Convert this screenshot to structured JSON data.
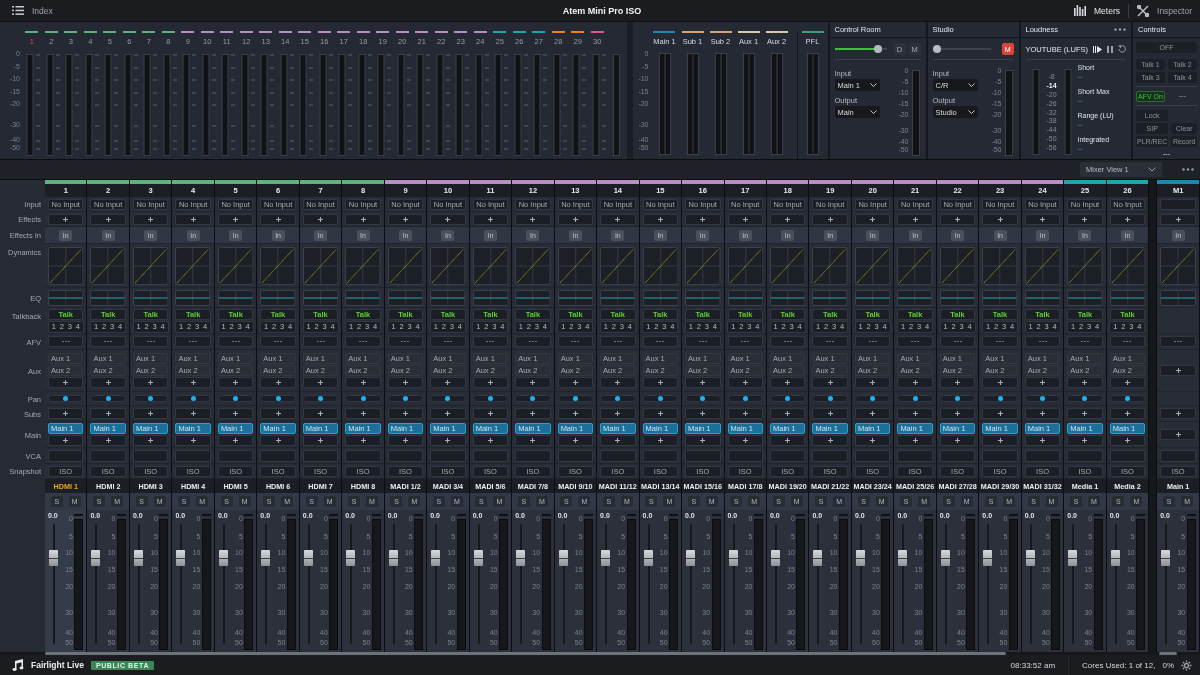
{
  "toolbar": {
    "index": "Index",
    "title": "Atem Mini Pro ISO",
    "meters": "Meters",
    "inspector": "Inspector"
  },
  "meter_bridge": {
    "scale": [
      "0",
      "-5",
      "-10",
      "-15",
      "-20",
      "-30",
      "-40",
      "-50"
    ],
    "channels": [
      {
        "number": "1",
        "color": "#5db37e",
        "selected": true
      },
      {
        "number": "2",
        "color": "#5db37e",
        "selected": false
      },
      {
        "number": "3",
        "color": "#5db37e",
        "selected": false
      },
      {
        "number": "4",
        "color": "#5db37e",
        "selected": false
      },
      {
        "number": "5",
        "color": "#5db37e",
        "selected": false
      },
      {
        "number": "6",
        "color": "#5db37e",
        "selected": false
      },
      {
        "number": "7",
        "color": "#5db37e",
        "selected": false
      },
      {
        "number": "8",
        "color": "#5db37e",
        "selected": false
      },
      {
        "number": "9",
        "color": "#b88dc6",
        "selected": false
      },
      {
        "number": "10",
        "color": "#b88dc6",
        "selected": false
      },
      {
        "number": "11",
        "color": "#b88dc6",
        "selected": false
      },
      {
        "number": "12",
        "color": "#b88dc6",
        "selected": false
      },
      {
        "number": "13",
        "color": "#b88dc6",
        "selected": false
      },
      {
        "number": "14",
        "color": "#b88dc6",
        "selected": false
      },
      {
        "number": "15",
        "color": "#b88dc6",
        "selected": false
      },
      {
        "number": "16",
        "color": "#b88dc6",
        "selected": false
      },
      {
        "number": "17",
        "color": "#b88dc6",
        "selected": false
      },
      {
        "number": "18",
        "color": "#b88dc6",
        "selected": false
      },
      {
        "number": "19",
        "color": "#b88dc6",
        "selected": false
      },
      {
        "number": "20",
        "color": "#b88dc6",
        "selected": false
      },
      {
        "number": "21",
        "color": "#b88dc6",
        "selected": false
      },
      {
        "number": "22",
        "color": "#b88dc6",
        "selected": false
      },
      {
        "number": "23",
        "color": "#b88dc6",
        "selected": false
      },
      {
        "number": "24",
        "color": "#b88dc6",
        "selected": false
      },
      {
        "number": "25",
        "color": "#1fa6ad",
        "selected": false
      },
      {
        "number": "26",
        "color": "#1fa6ad",
        "selected": false
      },
      {
        "number": "27",
        "color": "#1fa6ad",
        "selected": false
      },
      {
        "number": "28",
        "color": "#f07f1c",
        "selected": false
      },
      {
        "number": "29",
        "color": "#f07f1c",
        "selected": false
      },
      {
        "number": "30",
        "color": "#e0588a",
        "selected": false
      }
    ]
  },
  "buses": {
    "scale": [
      "0",
      "-5",
      "-10",
      "-15",
      "-20",
      "-30",
      "-40",
      "-50"
    ],
    "items": [
      {
        "name": "Main 1",
        "color": "#1f86b0"
      },
      {
        "name": "Sub 1",
        "color": "#d9a273"
      },
      {
        "name": "Sub 2",
        "color": "#d9a273"
      },
      {
        "name": "Aux 1",
        "color": "#d8caa6"
      },
      {
        "name": "Aux 2",
        "color": "#d8caa6"
      },
      {
        "name": "PFL",
        "color": "#3f9f78"
      }
    ]
  },
  "control_room": {
    "title": "Control Room",
    "level": 0.9,
    "dim": {
      "label": "D",
      "on": false
    },
    "mute": {
      "label": "M",
      "on": false
    },
    "input_label": "Input",
    "input": "Main 1",
    "output_label": "Output",
    "output": "Main",
    "scale": [
      "0",
      "-5",
      "-10",
      "-15",
      "-20",
      "-30",
      "-40",
      "-50"
    ]
  },
  "studio": {
    "title": "Studio",
    "level": 0,
    "mute": {
      "label": "M",
      "on": true
    },
    "input_label": "Input",
    "input": "C/R",
    "output_label": "Output",
    "output": "Studio",
    "scale": [
      "0",
      "-5",
      "-10",
      "-15",
      "-20",
      "-30",
      "-40",
      "-50"
    ]
  },
  "loudness": {
    "title": "Loudness",
    "standard": "YOUTUBE (LUFS)",
    "scale": [
      {
        "text": "-8",
        "selected": false
      },
      {
        "text": "-14",
        "selected": true
      },
      {
        "text": "-20",
        "selected": false
      },
      {
        "text": "-26",
        "selected": false
      },
      {
        "text": "-32",
        "selected": false
      },
      {
        "text": "-38",
        "selected": false
      },
      {
        "text": "-44",
        "selected": false
      },
      {
        "text": "-50",
        "selected": false
      },
      {
        "text": "-56",
        "selected": false
      }
    ],
    "readings": [
      {
        "label": "Short",
        "value": "--"
      },
      {
        "label": "Short Max",
        "value": "--"
      },
      {
        "label": "Range (LU)",
        "value": "--"
      },
      {
        "label": "Integrated",
        "value": "--"
      }
    ]
  },
  "controls": {
    "title": "Controls",
    "groups": [
      [
        {
          "label": "OFF",
          "kind": "wide",
          "on": false
        },
        {
          "label": "Talk 1",
          "kind": "button",
          "on": false
        },
        {
          "label": "Talk 2",
          "kind": "button",
          "on": false
        },
        {
          "label": "Talk 3",
          "kind": "button",
          "on": false
        },
        {
          "label": "Talk 4",
          "kind": "button",
          "on": false
        }
      ],
      [
        {
          "label": "AFV On",
          "kind": "button",
          "on": true
        },
        {
          "label": "---",
          "kind": "text"
        }
      ],
      [
        {
          "label": "Lock",
          "kind": "single",
          "on": false
        },
        {
          "label": "SIP",
          "kind": "button",
          "on": false
        },
        {
          "label": "Clear",
          "kind": "button",
          "on": false
        },
        {
          "label": "PLR/REC",
          "kind": "button",
          "on": false
        },
        {
          "label": "Record",
          "kind": "button",
          "on": false
        },
        {
          "label": "---",
          "kind": "wide-text"
        }
      ]
    ]
  },
  "mixer_view": "Mixer View 1",
  "row_labels": [
    "Input",
    "Effects",
    "Effects In",
    "Dynamics",
    "EQ",
    "Talkback",
    "AFV",
    "Aux",
    "Pan",
    "Subs",
    "Main",
    "VCA",
    "Snapshot"
  ],
  "strips": [
    {
      "kind": "channel",
      "number": "1",
      "color": "#5db37e",
      "input": "No Input",
      "effects_in": "In",
      "talk": "Talk",
      "talk_keys": [
        "1",
        "2",
        "3",
        "4"
      ],
      "aux": [
        "Aux 1",
        "Aux 2"
      ],
      "main": "Main 1",
      "snapshot": "ISO",
      "name": "HDMI 1",
      "selected": true,
      "solo": "S",
      "mute": "M",
      "gain": "0.0",
      "scale": [
        "0",
        "5",
        "10",
        "15",
        "20",
        "30",
        "40",
        "50"
      ]
    },
    {
      "kind": "channel",
      "number": "2",
      "color": "#5db37e",
      "input": "No Input",
      "effects_in": "In",
      "talk": "Talk",
      "talk_keys": [
        "1",
        "2",
        "3",
        "4"
      ],
      "aux": [
        "Aux 1",
        "Aux 2"
      ],
      "main": "Main 1",
      "snapshot": "ISO",
      "name": "HDMI 2",
      "selected": false,
      "solo": "S",
      "mute": "M",
      "gain": "0.0",
      "scale": [
        "0",
        "5",
        "10",
        "15",
        "20",
        "30",
        "40",
        "50"
      ]
    },
    {
      "kind": "channel",
      "number": "3",
      "color": "#5db37e",
      "input": "No Input",
      "effects_in": "In",
      "talk": "Talk",
      "talk_keys": [
        "1",
        "2",
        "3",
        "4"
      ],
      "aux": [
        "Aux 1",
        "Aux 2"
      ],
      "main": "Main 1",
      "snapshot": "ISO",
      "name": "HDMI 3",
      "selected": false,
      "solo": "S",
      "mute": "M",
      "gain": "0.0",
      "scale": [
        "0",
        "5",
        "10",
        "15",
        "20",
        "30",
        "40",
        "50"
      ]
    },
    {
      "kind": "channel",
      "number": "4",
      "color": "#5db37e",
      "input": "No Input",
      "effects_in": "In",
      "talk": "Talk",
      "talk_keys": [
        "1",
        "2",
        "3",
        "4"
      ],
      "aux": [
        "Aux 1",
        "Aux 2"
      ],
      "main": "Main 1",
      "snapshot": "ISO",
      "name": "HDMI 4",
      "selected": false,
      "solo": "S",
      "mute": "M",
      "gain": "0.0",
      "scale": [
        "0",
        "5",
        "10",
        "15",
        "20",
        "30",
        "40",
        "50"
      ]
    },
    {
      "kind": "channel",
      "number": "5",
      "color": "#5db37e",
      "input": "No Input",
      "effects_in": "In",
      "talk": "Talk",
      "talk_keys": [
        "1",
        "2",
        "3",
        "4"
      ],
      "aux": [
        "Aux 1",
        "Aux 2"
      ],
      "main": "Main 1",
      "snapshot": "ISO",
      "name": "HDMI 5",
      "selected": false,
      "solo": "S",
      "mute": "M",
      "gain": "0.0",
      "scale": [
        "0",
        "5",
        "10",
        "15",
        "20",
        "30",
        "40",
        "50"
      ]
    },
    {
      "kind": "channel",
      "number": "6",
      "color": "#5db37e",
      "input": "No Input",
      "effects_in": "In",
      "talk": "Talk",
      "talk_keys": [
        "1",
        "2",
        "3",
        "4"
      ],
      "aux": [
        "Aux 1",
        "Aux 2"
      ],
      "main": "Main 1",
      "snapshot": "ISO",
      "name": "HDMI 6",
      "selected": false,
      "solo": "S",
      "mute": "M",
      "gain": "0.0",
      "scale": [
        "0",
        "5",
        "10",
        "15",
        "20",
        "30",
        "40",
        "50"
      ]
    },
    {
      "kind": "channel",
      "number": "7",
      "color": "#5db37e",
      "input": "No Input",
      "effects_in": "In",
      "talk": "Talk",
      "talk_keys": [
        "1",
        "2",
        "3",
        "4"
      ],
      "aux": [
        "Aux 1",
        "Aux 2"
      ],
      "main": "Main 1",
      "snapshot": "ISO",
      "name": "HDMI 7",
      "selected": false,
      "solo": "S",
      "mute": "M",
      "gain": "0.0",
      "scale": [
        "0",
        "5",
        "10",
        "15",
        "20",
        "30",
        "40",
        "50"
      ]
    },
    {
      "kind": "channel",
      "number": "8",
      "color": "#5db37e",
      "input": "No Input",
      "effects_in": "In",
      "talk": "Talk",
      "talk_keys": [
        "1",
        "2",
        "3",
        "4"
      ],
      "aux": [
        "Aux 1",
        "Aux 2"
      ],
      "main": "Main 1",
      "snapshot": "ISO",
      "name": "HDMI 8",
      "selected": false,
      "solo": "S",
      "mute": "M",
      "gain": "0.0",
      "scale": [
        "0",
        "5",
        "10",
        "15",
        "20",
        "30",
        "40",
        "50"
      ]
    },
    {
      "kind": "channel",
      "number": "9",
      "color": "#b88dc6",
      "input": "No Input",
      "effects_in": "In",
      "talk": "Talk",
      "talk_keys": [
        "1",
        "2",
        "3",
        "4"
      ],
      "aux": [
        "Aux 1",
        "Aux 2"
      ],
      "main": "Main 1",
      "snapshot": "ISO",
      "name": "MADI 1/2",
      "selected": false,
      "solo": "S",
      "mute": "M",
      "gain": "0.0",
      "scale": [
        "0",
        "5",
        "10",
        "15",
        "20",
        "30",
        "40",
        "50"
      ]
    },
    {
      "kind": "channel",
      "number": "10",
      "color": "#b88dc6",
      "input": "No Input",
      "effects_in": "In",
      "talk": "Talk",
      "talk_keys": [
        "1",
        "2",
        "3",
        "4"
      ],
      "aux": [
        "Aux 1",
        "Aux 2"
      ],
      "main": "Main 1",
      "snapshot": "ISO",
      "name": "MADI 3/4",
      "selected": false,
      "solo": "S",
      "mute": "M",
      "gain": "0.0",
      "scale": [
        "0",
        "5",
        "10",
        "15",
        "20",
        "30",
        "40",
        "50"
      ]
    },
    {
      "kind": "channel",
      "number": "11",
      "color": "#b88dc6",
      "input": "No Input",
      "effects_in": "In",
      "talk": "Talk",
      "talk_keys": [
        "1",
        "2",
        "3",
        "4"
      ],
      "aux": [
        "Aux 1",
        "Aux 2"
      ],
      "main": "Main 1",
      "snapshot": "ISO",
      "name": "MADI 5/6",
      "selected": false,
      "solo": "S",
      "mute": "M",
      "gain": "0.0",
      "scale": [
        "0",
        "5",
        "10",
        "15",
        "20",
        "30",
        "40",
        "50"
      ]
    },
    {
      "kind": "channel",
      "number": "12",
      "color": "#b88dc6",
      "input": "No Input",
      "effects_in": "In",
      "talk": "Talk",
      "talk_keys": [
        "1",
        "2",
        "3",
        "4"
      ],
      "aux": [
        "Aux 1",
        "Aux 2"
      ],
      "main": "Main 1",
      "snapshot": "ISO",
      "name": "MADI 7/8",
      "selected": false,
      "solo": "S",
      "mute": "M",
      "gain": "0.0",
      "scale": [
        "0",
        "5",
        "10",
        "15",
        "20",
        "30",
        "40",
        "50"
      ]
    },
    {
      "kind": "channel",
      "number": "13",
      "color": "#b88dc6",
      "input": "No Input",
      "effects_in": "In",
      "talk": "Talk",
      "talk_keys": [
        "1",
        "2",
        "3",
        "4"
      ],
      "aux": [
        "Aux 1",
        "Aux 2"
      ],
      "main": "Main 1",
      "snapshot": "ISO",
      "name": "MADI 9/10",
      "selected": false,
      "solo": "S",
      "mute": "M",
      "gain": "0.0",
      "scale": [
        "0",
        "5",
        "10",
        "15",
        "20",
        "30",
        "40",
        "50"
      ]
    },
    {
      "kind": "channel",
      "number": "14",
      "color": "#b88dc6",
      "input": "No Input",
      "effects_in": "In",
      "talk": "Talk",
      "talk_keys": [
        "1",
        "2",
        "3",
        "4"
      ],
      "aux": [
        "Aux 1",
        "Aux 2"
      ],
      "main": "Main 1",
      "snapshot": "ISO",
      "name": "MADI 11/12",
      "selected": false,
      "solo": "S",
      "mute": "M",
      "gain": "0.0",
      "scale": [
        "0",
        "5",
        "10",
        "15",
        "20",
        "30",
        "40",
        "50"
      ]
    },
    {
      "kind": "channel",
      "number": "15",
      "color": "#b88dc6",
      "input": "No Input",
      "effects_in": "In",
      "talk": "Talk",
      "talk_keys": [
        "1",
        "2",
        "3",
        "4"
      ],
      "aux": [
        "Aux 1",
        "Aux 2"
      ],
      "main": "Main 1",
      "snapshot": "ISO",
      "name": "MADI 13/14",
      "selected": false,
      "solo": "S",
      "mute": "M",
      "gain": "0.0",
      "scale": [
        "0",
        "5",
        "10",
        "15",
        "20",
        "30",
        "40",
        "50"
      ]
    },
    {
      "kind": "channel",
      "number": "16",
      "color": "#b88dc6",
      "input": "No Input",
      "effects_in": "In",
      "talk": "Talk",
      "talk_keys": [
        "1",
        "2",
        "3",
        "4"
      ],
      "aux": [
        "Aux 1",
        "Aux 2"
      ],
      "main": "Main 1",
      "snapshot": "ISO",
      "name": "MADI 15/16",
      "selected": false,
      "solo": "S",
      "mute": "M",
      "gain": "0.0",
      "scale": [
        "0",
        "5",
        "10",
        "15",
        "20",
        "30",
        "40",
        "50"
      ]
    },
    {
      "kind": "channel",
      "number": "17",
      "color": "#b88dc6",
      "input": "No Input",
      "effects_in": "In",
      "talk": "Talk",
      "talk_keys": [
        "1",
        "2",
        "3",
        "4"
      ],
      "aux": [
        "Aux 1",
        "Aux 2"
      ],
      "main": "Main 1",
      "snapshot": "ISO",
      "name": "MADI 17/8",
      "selected": false,
      "solo": "S",
      "mute": "M",
      "gain": "0.0",
      "scale": [
        "0",
        "5",
        "10",
        "15",
        "20",
        "30",
        "40",
        "50"
      ]
    },
    {
      "kind": "channel",
      "number": "18",
      "color": "#b88dc6",
      "input": "No Input",
      "effects_in": "In",
      "talk": "Talk",
      "talk_keys": [
        "1",
        "2",
        "3",
        "4"
      ],
      "aux": [
        "Aux 1",
        "Aux 2"
      ],
      "main": "Main 1",
      "snapshot": "ISO",
      "name": "MADI 19/20",
      "selected": false,
      "solo": "S",
      "mute": "M",
      "gain": "0.0",
      "scale": [
        "0",
        "5",
        "10",
        "15",
        "20",
        "30",
        "40",
        "50"
      ]
    },
    {
      "kind": "channel",
      "number": "19",
      "color": "#b88dc6",
      "input": "No Input",
      "effects_in": "In",
      "talk": "Talk",
      "talk_keys": [
        "1",
        "2",
        "3",
        "4"
      ],
      "aux": [
        "Aux 1",
        "Aux 2"
      ],
      "main": "Main 1",
      "snapshot": "ISO",
      "name": "MADI 21/22",
      "selected": false,
      "solo": "S",
      "mute": "M",
      "gain": "0.0",
      "scale": [
        "0",
        "5",
        "10",
        "15",
        "20",
        "30",
        "40",
        "50"
      ]
    },
    {
      "kind": "channel",
      "number": "20",
      "color": "#b88dc6",
      "input": "No Input",
      "effects_in": "In",
      "talk": "Talk",
      "talk_keys": [
        "1",
        "2",
        "3",
        "4"
      ],
      "aux": [
        "Aux 1",
        "Aux 2"
      ],
      "main": "Main 1",
      "snapshot": "ISO",
      "name": "MADI 23/24",
      "selected": false,
      "solo": "S",
      "mute": "M",
      "gain": "0.0",
      "scale": [
        "0",
        "5",
        "10",
        "15",
        "20",
        "30",
        "40",
        "50"
      ]
    },
    {
      "kind": "channel",
      "number": "21",
      "color": "#b88dc6",
      "input": "No Input",
      "effects_in": "In",
      "talk": "Talk",
      "talk_keys": [
        "1",
        "2",
        "3",
        "4"
      ],
      "aux": [
        "Aux 1",
        "Aux 2"
      ],
      "main": "Main 1",
      "snapshot": "ISO",
      "name": "MADI 25/26",
      "selected": false,
      "solo": "S",
      "mute": "M",
      "gain": "0.0",
      "scale": [
        "0",
        "5",
        "10",
        "15",
        "20",
        "30",
        "40",
        "50"
      ]
    },
    {
      "kind": "channel",
      "number": "22",
      "color": "#b88dc6",
      "input": "No Input",
      "effects_in": "In",
      "talk": "Talk",
      "talk_keys": [
        "1",
        "2",
        "3",
        "4"
      ],
      "aux": [
        "Aux 1",
        "Aux 2"
      ],
      "main": "Main 1",
      "snapshot": "ISO",
      "name": "MADI 27/28",
      "selected": false,
      "solo": "S",
      "mute": "M",
      "gain": "0.0",
      "scale": [
        "0",
        "5",
        "10",
        "15",
        "20",
        "30",
        "40",
        "50"
      ]
    },
    {
      "kind": "channel",
      "number": "23",
      "color": "#b88dc6",
      "input": "No Input",
      "effects_in": "In",
      "talk": "Talk",
      "talk_keys": [
        "1",
        "2",
        "3",
        "4"
      ],
      "aux": [
        "Aux 1",
        "Aux 2"
      ],
      "main": "Main 1",
      "snapshot": "ISO",
      "name": "MADI 29/30",
      "selected": false,
      "solo": "S",
      "mute": "M",
      "gain": "0.0",
      "scale": [
        "0",
        "5",
        "10",
        "15",
        "20",
        "30",
        "40",
        "50"
      ]
    },
    {
      "kind": "channel",
      "number": "24",
      "color": "#b88dc6",
      "input": "No Input",
      "effects_in": "In",
      "talk": "Talk",
      "talk_keys": [
        "1",
        "2",
        "3",
        "4"
      ],
      "aux": [
        "Aux 1",
        "Aux 2"
      ],
      "main": "Main 1",
      "snapshot": "ISO",
      "name": "MADI 31/32",
      "selected": false,
      "solo": "S",
      "mute": "M",
      "gain": "0.0",
      "scale": [
        "0",
        "5",
        "10",
        "15",
        "20",
        "30",
        "40",
        "50"
      ]
    },
    {
      "kind": "channel",
      "number": "25",
      "color": "#1fa6ad",
      "input": "No Input",
      "effects_in": "In",
      "talk": "Talk",
      "talk_keys": [
        "1",
        "2",
        "3",
        "4"
      ],
      "aux": [
        "Aux 1",
        "Aux 2"
      ],
      "main": "Main 1",
      "snapshot": "ISO",
      "name": "Media 1",
      "selected": false,
      "solo": "S",
      "mute": "M",
      "gain": "0.0",
      "scale": [
        "0",
        "5",
        "10",
        "15",
        "20",
        "30",
        "40",
        "50"
      ]
    },
    {
      "kind": "channel",
      "number": "26",
      "color": "#1fa6ad",
      "input": "No Input",
      "effects_in": "In",
      "talk": "Talk",
      "talk_keys": [
        "1",
        "2",
        "3",
        "4"
      ],
      "aux": [
        "Aux 1",
        "Aux 2"
      ],
      "main": "Main 1",
      "snapshot": "ISO",
      "name": "Media 2",
      "selected": false,
      "solo": "S",
      "mute": "M",
      "gain": "0.0",
      "scale": [
        "0",
        "5",
        "10",
        "15",
        "20",
        "30",
        "40",
        "50"
      ]
    },
    {
      "kind": "master",
      "number": "M1",
      "color": "#1f86b0",
      "effects_in": "In",
      "snapshot": "ISO",
      "name": "Main 1",
      "selected": false,
      "solo": "S",
      "mute": "M",
      "gain": "0.0",
      "scale": [
        "0",
        "5",
        "10",
        "15",
        "20",
        "30",
        "40",
        "50"
      ]
    }
  ],
  "status": {
    "app": "Fairlight Live",
    "badge": "PUBLIC BETA",
    "time": "08:33:52 am",
    "cores": "Cores Used: 1 of 12,",
    "load": "0%"
  }
}
